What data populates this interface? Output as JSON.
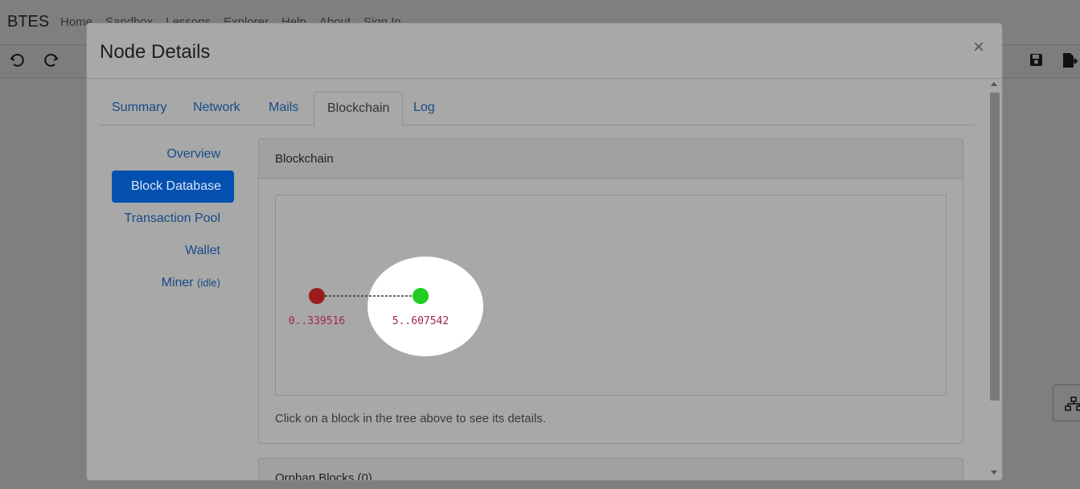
{
  "app": {
    "brand": "BTES",
    "nav": [
      "Home",
      "Sandbox",
      "Lessons",
      "Explorer",
      "Help",
      "About",
      "Sign In"
    ]
  },
  "toolbar": {
    "undo_icon": "undo-icon",
    "redo_icon": "redo-icon",
    "save_icon": "save-icon",
    "export_icon": "export-icon",
    "network_icon": "network-icon"
  },
  "modal": {
    "title": "Node Details",
    "close_label": "×",
    "tabs": [
      {
        "label": "Summary",
        "active": false
      },
      {
        "label": "Network",
        "active": false
      },
      {
        "label": "Mails",
        "active": false
      },
      {
        "label": "Blockchain",
        "active": true
      },
      {
        "label": "Log",
        "active": false
      }
    ],
    "sidebar": [
      {
        "label": "Overview"
      },
      {
        "label": "Block Database",
        "active": true
      },
      {
        "label": "Transaction Pool"
      },
      {
        "label": "Wallet"
      },
      {
        "label": "Miner",
        "status": "(idle)"
      }
    ],
    "blockchain_card": {
      "title": "Blockchain",
      "blocks": [
        {
          "label": "0..339516",
          "color": "#9b1c1c"
        },
        {
          "label": "5..607542",
          "color": "#22cc22"
        }
      ],
      "hint": "Click on a block in the tree above to see its details."
    },
    "orphan_card": {
      "title": "Orphan Blocks (0)"
    }
  },
  "colors": {
    "link": "#184b87",
    "active_pill": "#0350b0",
    "backdrop": "rgba(0,0,0,0.5)"
  }
}
